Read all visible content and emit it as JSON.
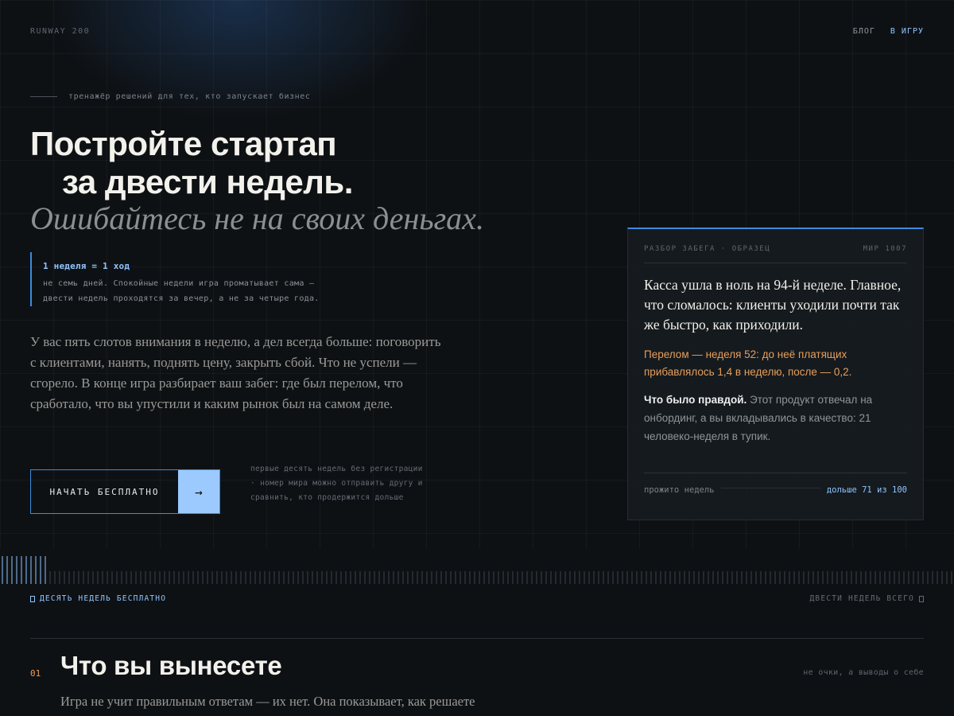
{
  "header": {
    "logo": "RUNWAY 200",
    "nav": [
      {
        "label": "БЛОГ"
      },
      {
        "label": "В ИГРУ"
      }
    ]
  },
  "hero": {
    "eyebrow": "тренажёр решений для тех, кто запускает бизнес",
    "title_line1": "Постройте стартап",
    "title_line2": "за двести недель.",
    "title_italic": "Ошибайтесь не на своих деньгах.",
    "rule_title": "1 неделя = 1 ход",
    "rule_text_line1": "не семь дней. Спокойные недели игра проматывает сама —",
    "rule_text_line2": "двести недель проходятся за вечер, а не за четыре года.",
    "body": "У вас пять слотов внимания в неделю, а дел всегда больше: поговорить с клиентами, нанять, поднять цену, закрыть сбой. Что не успели — сгорело. В конце игра разбирает ваш забег: где был перелом, что сработало, что вы упустили и каким рынок был на самом деле.",
    "cta_label": "НАЧАТЬ БЕСПЛАТНО",
    "cta_arrow": "→",
    "cta_note": "первые десять недель без регистрации · номер мира можно отправить другу и сравнить, кто продержится дольше"
  },
  "card": {
    "header_left": "РАЗБОР ЗАБЕГА · ОБРАЗЕЦ",
    "header_right": "МИР 1007",
    "main": "Касса ушла в ноль на 94-й неделе. Главное, что сломалось: клиенты уходили почти так же быстро, как приходили.",
    "turning_point": "Перелом — неделя 52: до неё платящих прибавлялось 1,4 в неделю, после — 0,2.",
    "truth_label": "Что было правдой.",
    "truth_text": " Этот продукт отвечал на онбординг, а вы вкладывались в качество: 21 человеко-неделя в тупик.",
    "footer_label": "прожито недель",
    "footer_value": "дольше 71 из 100"
  },
  "timeline": {
    "total_weeks": 200,
    "free_weeks": 10,
    "left_label": "ДЕСЯТЬ НЕДЕЛЬ БЕСПЛАТНО",
    "right_label": "ДВЕСТИ НЕДЕЛЬ ВСЕГО"
  },
  "section": {
    "number": "01",
    "title": "Что вы вынесете",
    "side_note": "не очки, а выводы о себе",
    "text": "Игра не учит правильным ответам — их нет. Она показывает, как решаете"
  },
  "colors": {
    "accent_blue": "#8fc4ff",
    "accent_blue_strong": "#3d8bde",
    "accent_orange": "#e79e5b",
    "background": "#0e1114"
  }
}
